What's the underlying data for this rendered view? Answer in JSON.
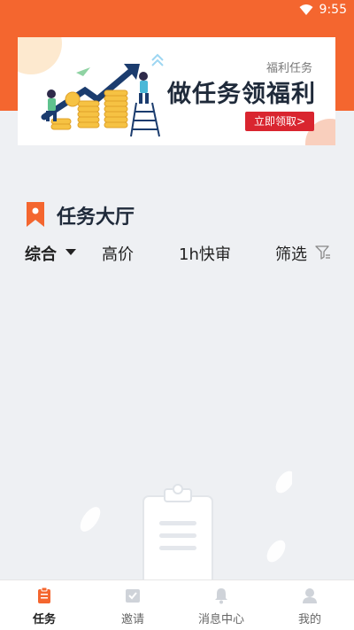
{
  "status_bar": {
    "time": "9:55"
  },
  "banner": {
    "subtitle": "福利任务",
    "title": "做任务领福利",
    "button": "立即领取>"
  },
  "section": {
    "title": "任务大厅"
  },
  "filters": [
    {
      "label": "综合",
      "active": true
    },
    {
      "label": "高价"
    },
    {
      "label": "1h快审"
    },
    {
      "label": "筛选"
    }
  ],
  "bottom_nav": [
    {
      "label": "任务",
      "active": true
    },
    {
      "label": "邀请"
    },
    {
      "label": "消息中心"
    },
    {
      "label": "我的"
    }
  ],
  "colors": {
    "brand_orange": "#f4662f",
    "button_red": "#d9252f",
    "background": "#eef0f3"
  }
}
